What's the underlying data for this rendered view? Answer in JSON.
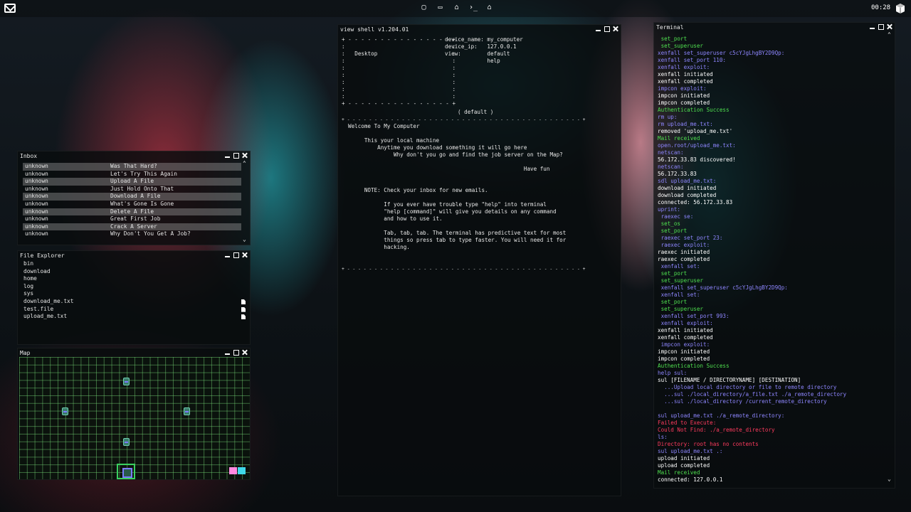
{
  "topbar": {
    "clock": "00:28",
    "icons": [
      "square-icon",
      "monitor-icon",
      "lock-icon",
      "terminal-icon",
      "lock-icon"
    ]
  },
  "inbox": {
    "title": "Inbox",
    "rows": [
      {
        "from": "unknown",
        "subject": "Was That Hard?"
      },
      {
        "from": "unknown",
        "subject": "Let's Try This Again"
      },
      {
        "from": "unknown",
        "subject": "Upload A File"
      },
      {
        "from": "unknown",
        "subject": "Just Hold Onto That"
      },
      {
        "from": "unknown",
        "subject": "Download A File"
      },
      {
        "from": "unknown",
        "subject": "What's Gone Is Gone"
      },
      {
        "from": "unknown",
        "subject": "Delete A File"
      },
      {
        "from": "unknown",
        "subject": "Great First Job"
      },
      {
        "from": "unknown",
        "subject": "Crack A Server"
      },
      {
        "from": "unknown",
        "subject": "Why Don't You Get A Job?"
      }
    ]
  },
  "files": {
    "title": "File Explorer",
    "items": [
      {
        "name": "bin",
        "is_file": false
      },
      {
        "name": "download",
        "is_file": false
      },
      {
        "name": "home",
        "is_file": false
      },
      {
        "name": "log",
        "is_file": false
      },
      {
        "name": "sys",
        "is_file": false
      },
      {
        "name": "download_me.txt",
        "is_file": true
      },
      {
        "name": "test.file",
        "is_file": true
      },
      {
        "name": "upload_me.txt",
        "is_file": true
      }
    ]
  },
  "map": {
    "title": "Map"
  },
  "shell": {
    "title": "view shell v1.204.01",
    "box_top": "+ - - - - - - - - - - - - - - - - +",
    "box_side": ":                                 :",
    "box_desktop": ":   Desktop                       :",
    "info": "device_name: my_computer\ndevice_ip:   127.0.0.1\nview:        default\n             help",
    "view_mode": "( default )",
    "dots": "+ - - - - - - - - - - - - - - - - - - - - - - - - - - - - - - - - - - - - - - - - - - - +",
    "welcome": "Welcome To My Computer",
    "body": "     This your local machine\n         Anytime you download something it will go here\n              Why don't you go and find the job server on the Map?\n\n                                                      Have fun\n\n\n     NOTE: Check your inbox for new emails.\n\n           If you ever have trouble type \"help\" into terminal\n           \"help [command]\" will give you details on any command\n           and how to use it.\n\n           Tab, tab, tab. The terminal has predictive text for most\n           things so press tab to type faster. You will need it for\n           hacking."
  },
  "terminal": {
    "title": "Terminal",
    "lines": [
      {
        "t": " set_port",
        "c": "g"
      },
      {
        "t": " set_superuser",
        "c": "g"
      },
      {
        "t": "xenfall set_superuser c5cYJgLhgBY2D9Qp:",
        "c": "b"
      },
      {
        "t": "xenfall set_port 110:",
        "c": "b"
      },
      {
        "t": "xenfall exploit:",
        "c": "b"
      },
      {
        "t": "xenfall initiated",
        "c": "w"
      },
      {
        "t": "xenfall completed",
        "c": "w"
      },
      {
        "t": "impcon exploit:",
        "c": "b"
      },
      {
        "t": "impcon initiated",
        "c": "w"
      },
      {
        "t": "impcon completed",
        "c": "w"
      },
      {
        "t": "Authentication Success",
        "c": "g"
      },
      {
        "t": "rm up:",
        "c": "b"
      },
      {
        "t": "rm upload_me.txt:",
        "c": "b"
      },
      {
        "t": "removed 'upload_me.txt'",
        "c": "w"
      },
      {
        "t": "Mail received",
        "c": "g"
      },
      {
        "t": "open.root/upload_me.txt:",
        "c": "b"
      },
      {
        "t": "netscan:",
        "c": "b"
      },
      {
        "t": "56.172.33.83 discovered!",
        "c": "w"
      },
      {
        "t": "netscan:",
        "c": "b"
      },
      {
        "t": "56.172.33.83",
        "c": "w"
      },
      {
        "t": "sdl upload_me.txt:",
        "c": "b"
      },
      {
        "t": "download initiated",
        "c": "w"
      },
      {
        "t": "download completed",
        "c": "w"
      },
      {
        "t": "connected: 56.172.33.83",
        "c": "w"
      },
      {
        "t": "uprint:",
        "c": "b"
      },
      {
        "t": " raexec se:",
        "c": "b"
      },
      {
        "t": " set_os",
        "c": "g"
      },
      {
        "t": " set_port",
        "c": "g"
      },
      {
        "t": " raexec set_port 23:",
        "c": "b"
      },
      {
        "t": " raexec exploit:",
        "c": "b"
      },
      {
        "t": "raexec initiated",
        "c": "w"
      },
      {
        "t": "raexec completed",
        "c": "w"
      },
      {
        "t": " xenfall set:",
        "c": "b"
      },
      {
        "t": " set_port",
        "c": "g"
      },
      {
        "t": " set_superuser",
        "c": "g"
      },
      {
        "t": " xenfall set_superuser c5cYJgLhgBY2D9Qp:",
        "c": "b"
      },
      {
        "t": " xenfall set:",
        "c": "b"
      },
      {
        "t": " set_port",
        "c": "g"
      },
      {
        "t": " set_superuser",
        "c": "g"
      },
      {
        "t": " xenfall set_port 993:",
        "c": "b"
      },
      {
        "t": " xenfall exploit:",
        "c": "b"
      },
      {
        "t": "xenfall initiated",
        "c": "w"
      },
      {
        "t": "xenfall completed",
        "c": "w"
      },
      {
        "t": " impcon exploit:",
        "c": "b"
      },
      {
        "t": "impcon initiated",
        "c": "w"
      },
      {
        "t": "impcon completed",
        "c": "w"
      },
      {
        "t": "Authentication Success",
        "c": "g"
      },
      {
        "t": "help sul:",
        "c": "b"
      },
      {
        "t": "sul [FILENAME / DIRECTORYNAME] [DESTINATION]",
        "c": "w"
      },
      {
        "t": "  ...Upload local directory or file to remote directory",
        "c": "b"
      },
      {
        "t": "  ...sul ./local_directory/a_file.txt ./a_remote_directory",
        "c": "b"
      },
      {
        "t": "  ...sul ./local_directory /current_remote_directory",
        "c": "b"
      },
      {
        "t": "",
        "c": "w"
      },
      {
        "t": "sul upload_me.txt ./a_remote_directory:",
        "c": "b"
      },
      {
        "t": "Failed to Execute:",
        "c": "r"
      },
      {
        "t": "Could Not Find: ./a_remote_directory",
        "c": "r"
      },
      {
        "t": "ls:",
        "c": "b"
      },
      {
        "t": "Directory: root has no contents",
        "c": "r"
      },
      {
        "t": "sul upload_me.txt .:",
        "c": "b"
      },
      {
        "t": "upload initiated",
        "c": "w"
      },
      {
        "t": "upload completed",
        "c": "w"
      },
      {
        "t": "Mail received",
        "c": "g"
      },
      {
        "t": "connected: 127.0.0.1",
        "c": "w"
      }
    ]
  },
  "colors": {
    "green": "#4fe04f",
    "blue": "#8e86ff",
    "red": "#ff3b5e",
    "white": "#ffffff"
  }
}
